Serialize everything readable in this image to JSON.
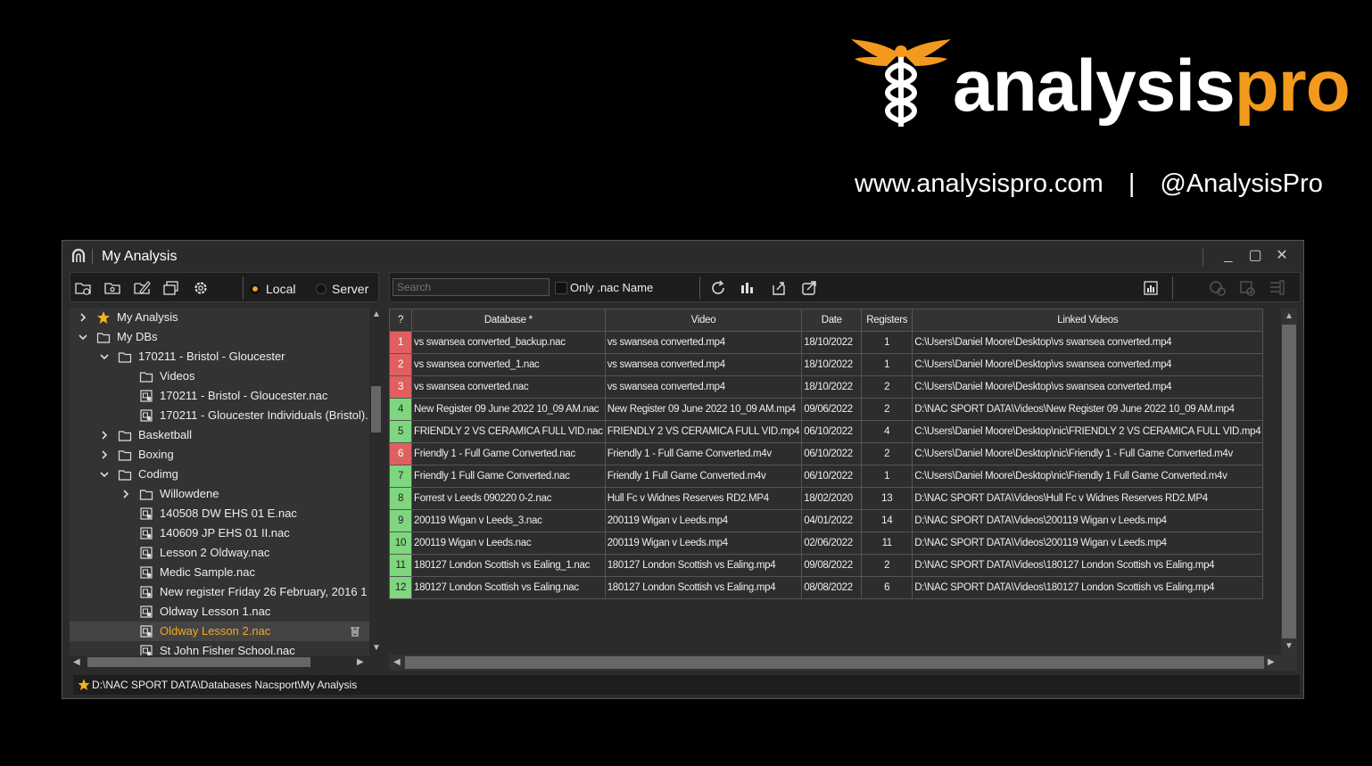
{
  "brand": {
    "name_part1": "analysis",
    "name_part2": "pro",
    "website": "www.analysispro.com",
    "separator": "|",
    "handle": "@AnalysisPro",
    "accent": "#f39a1e"
  },
  "window": {
    "title": "My Analysis",
    "controls": {
      "minimize": "_",
      "maximize": "▢",
      "close": "✕"
    }
  },
  "left_toolbar": {
    "radio_local": "Local",
    "radio_server": "Server",
    "selected": "Local"
  },
  "tree": {
    "items": [
      {
        "label": "My Analysis"
      },
      {
        "label": "My DBs"
      },
      {
        "label": "170211 - Bristol - Gloucester"
      },
      {
        "label": "Videos"
      },
      {
        "label": "170211 - Bristol - Gloucester.nac"
      },
      {
        "label": "170211 - Gloucester Individuals (Bristol)."
      },
      {
        "label": "Basketball"
      },
      {
        "label": "Boxing"
      },
      {
        "label": "Codimg"
      },
      {
        "label": "Willowdene"
      },
      {
        "label": "140508 DW EHS 01 E.nac"
      },
      {
        "label": "140609 JP EHS 01 II.nac"
      },
      {
        "label": "Lesson 2 Oldway.nac"
      },
      {
        "label": "Medic Sample.nac"
      },
      {
        "label": "New register Friday 26 February, 2016 1"
      },
      {
        "label": "Oldway Lesson 1.nac"
      },
      {
        "label": "Oldway Lesson 2.nac"
      },
      {
        "label": "St John Fisher School.nac"
      }
    ],
    "selected": "Oldway Lesson 2.nac"
  },
  "right_toolbar": {
    "search_placeholder": "Search",
    "only_nac_label": "Only .nac Name"
  },
  "table": {
    "headers": [
      "?",
      "Database *",
      "Video",
      "Date",
      "Registers",
      "Linked Videos"
    ],
    "rows": [
      {
        "n": "1",
        "status": "red",
        "db": "vs swansea converted_backup.nac",
        "video": "vs swansea converted.mp4",
        "date": "18/10/2022",
        "reg": "1",
        "linked": "C:\\Users\\Daniel Moore\\Desktop\\vs swansea converted.mp4"
      },
      {
        "n": "2",
        "status": "red",
        "db": "vs swansea converted_1.nac",
        "video": "vs swansea converted.mp4",
        "date": "18/10/2022",
        "reg": "1",
        "linked": "C:\\Users\\Daniel Moore\\Desktop\\vs swansea converted.mp4"
      },
      {
        "n": "3",
        "status": "red",
        "db": "vs swansea converted.nac",
        "video": "vs swansea converted.mp4",
        "date": "18/10/2022",
        "reg": "2",
        "linked": "C:\\Users\\Daniel Moore\\Desktop\\vs swansea converted.mp4"
      },
      {
        "n": "4",
        "status": "green",
        "db": "New Register 09 June 2022 10_09 AM.nac",
        "video": "New Register 09 June 2022 10_09 AM.mp4",
        "date": "09/06/2022",
        "reg": "2",
        "linked": "D:\\NAC SPORT DATA\\Videos\\New Register 09 June 2022 10_09 AM.mp4"
      },
      {
        "n": "5",
        "status": "green",
        "db": "FRIENDLY 2 VS CERAMICA FULL VID.nac",
        "video": "FRIENDLY 2 VS CERAMICA FULL VID.mp4",
        "date": "06/10/2022",
        "reg": "4",
        "linked": "C:\\Users\\Daniel Moore\\Desktop\\nic\\FRIENDLY 2 VS CERAMICA FULL VID.mp4"
      },
      {
        "n": "6",
        "status": "red",
        "db": "Friendly 1 - Full Game Converted.nac",
        "video": "Friendly 1 - Full Game Converted.m4v",
        "date": "06/10/2022",
        "reg": "2",
        "linked": "C:\\Users\\Daniel Moore\\Desktop\\nic\\Friendly 1 - Full Game Converted.m4v"
      },
      {
        "n": "7",
        "status": "green",
        "db": "Friendly 1  Full Game Converted.nac",
        "video": "Friendly 1  Full Game Converted.m4v",
        "date": "06/10/2022",
        "reg": "1",
        "linked": "C:\\Users\\Daniel Moore\\Desktop\\nic\\Friendly 1  Full Game Converted.m4v"
      },
      {
        "n": "8",
        "status": "green",
        "db": "Forrest v Leeds 090220 0-2.nac",
        "video": "Hull Fc v Widnes Reserves RD2.MP4",
        "date": "18/02/2020",
        "reg": "13",
        "linked": "D:\\NAC SPORT DATA\\Videos\\Hull Fc v Widnes Reserves RD2.MP4"
      },
      {
        "n": "9",
        "status": "green",
        "db": "200119 Wigan v Leeds_3.nac",
        "video": "200119 Wigan v Leeds.mp4",
        "date": "04/01/2022",
        "reg": "14",
        "linked": "D:\\NAC SPORT DATA\\Videos\\200119 Wigan v Leeds.mp4"
      },
      {
        "n": "10",
        "status": "green",
        "db": "200119 Wigan v Leeds.nac",
        "video": "200119 Wigan v Leeds.mp4",
        "date": "02/06/2022",
        "reg": "11",
        "linked": "D:\\NAC SPORT DATA\\Videos\\200119 Wigan v Leeds.mp4"
      },
      {
        "n": "11",
        "status": "green",
        "db": "180127 London Scottish vs Ealing_1.nac",
        "video": "180127 London Scottish vs Ealing.mp4",
        "date": "09/08/2022",
        "reg": "2",
        "linked": "D:\\NAC SPORT DATA\\Videos\\180127 London Scottish vs Ealing.mp4"
      },
      {
        "n": "12",
        "status": "green",
        "db": "180127 London Scottish vs Ealing.nac",
        "video": "180127 London Scottish vs Ealing.mp4",
        "date": "08/08/2022",
        "reg": "6",
        "linked": "D:\\NAC SPORT DATA\\Videos\\180127 London Scottish vs Ealing.mp4"
      }
    ]
  },
  "status_bar": {
    "path": "D:\\NAC SPORT DATA\\Databases Nacsport\\My Analysis"
  },
  "colors": {
    "red_status": "#e06060",
    "green_status": "#7fd67f",
    "selection": "#f3a81c"
  }
}
